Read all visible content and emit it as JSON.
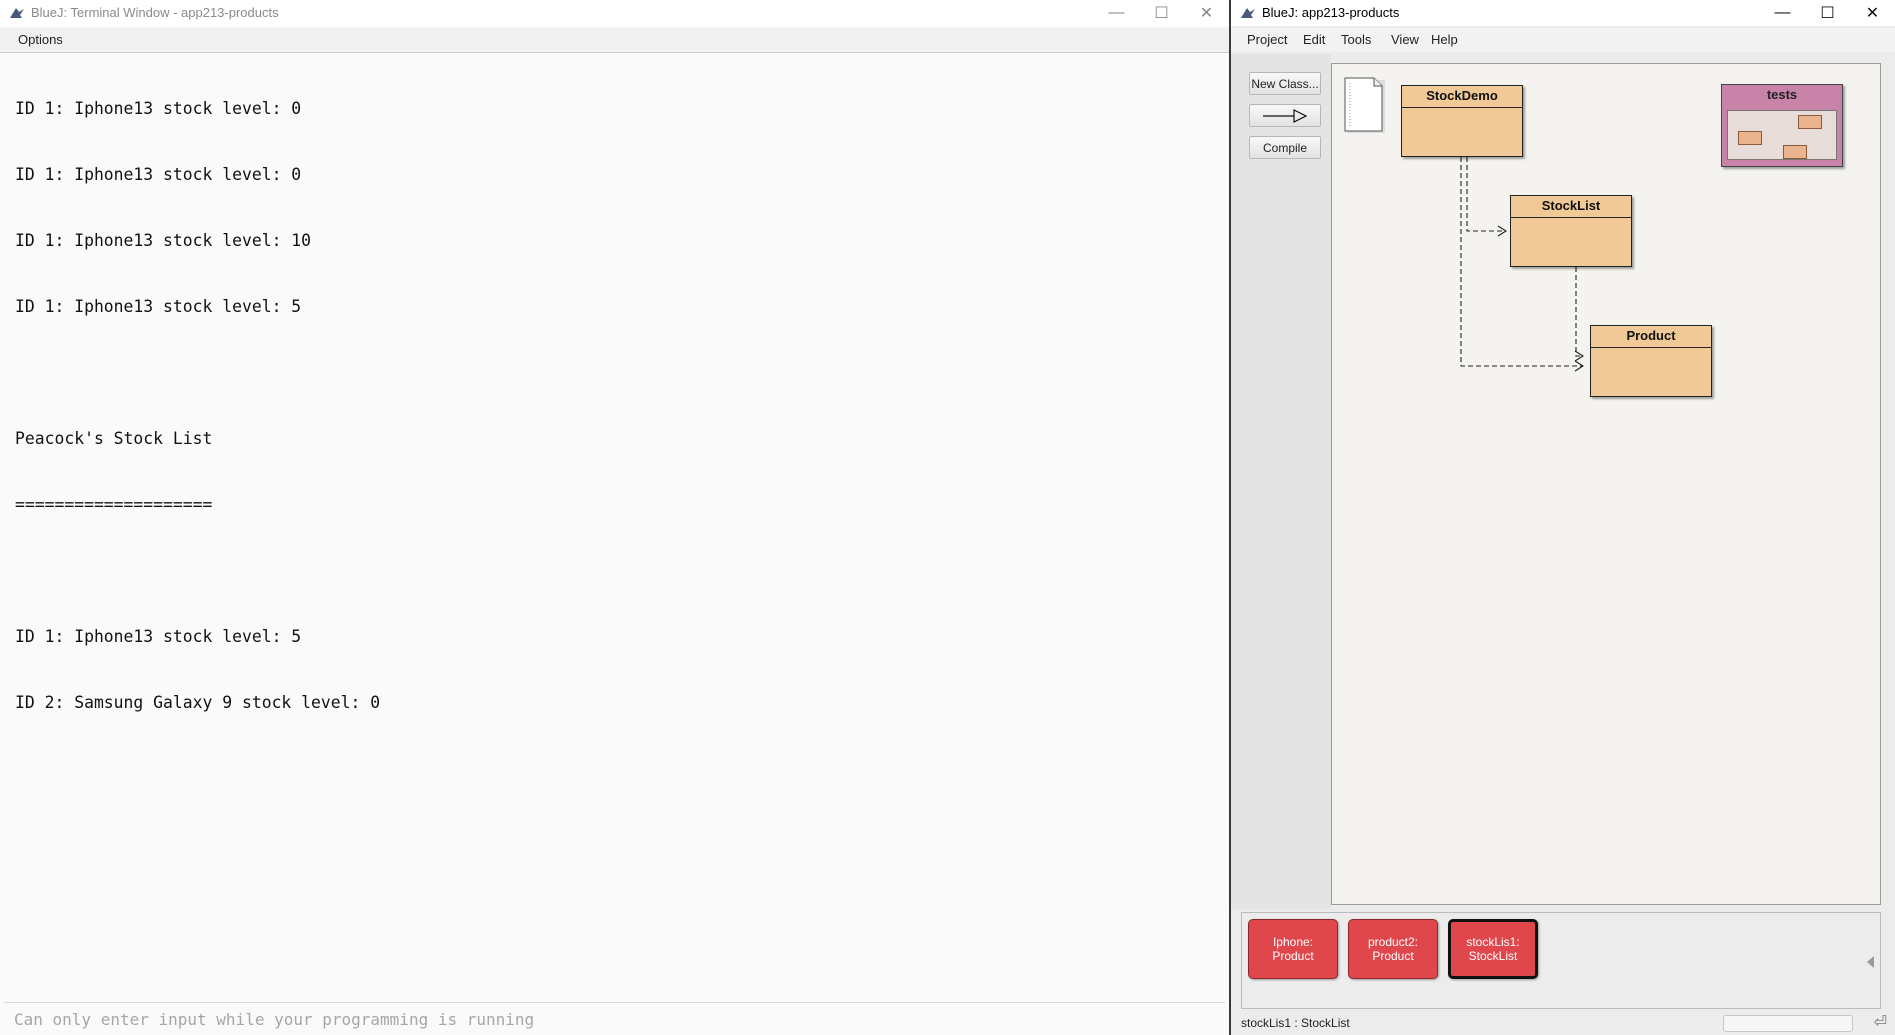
{
  "terminal": {
    "title": "BlueJ: Terminal Window - app213-products",
    "menu": {
      "options": "Options"
    },
    "output_lines": [
      "ID 1: Iphone13 stock level: 0",
      "ID 1: Iphone13 stock level: 0",
      "ID 1: Iphone13 stock level: 10",
      "ID 1: Iphone13 stock level: 5",
      "",
      "Peacock's Stock List",
      "====================",
      "",
      "ID 1: Iphone13 stock level: 5",
      "ID 2: Samsung Galaxy 9 stock level: 0"
    ],
    "input_placeholder": "Can only enter input while your programming is running",
    "controls": {
      "minimize": "—",
      "maximize": "☐",
      "close": "✕"
    }
  },
  "bluej": {
    "title": "BlueJ:  app213-products",
    "menu": {
      "project": "Project",
      "edit": "Edit",
      "tools": "Tools",
      "view": "View",
      "help": "Help"
    },
    "toolbar": {
      "new_class": "New Class...",
      "arrow": "—▷",
      "compile": "Compile"
    },
    "controls": {
      "minimize": "—",
      "maximize": "☐",
      "close": "✕"
    },
    "classes": {
      "stockdemo": "StockDemo",
      "stocklist": "StockList",
      "product": "Product"
    },
    "package": {
      "tests": "tests"
    },
    "objects": [
      {
        "line1": "Iphone:",
        "line2": "Product"
      },
      {
        "line1": "product2:",
        "line2": "Product"
      },
      {
        "line1": "stockLis1:",
        "line2": "StockList"
      }
    ],
    "status": "stockLis1 : StockList",
    "icons": {
      "app": "bluej-bird-icon",
      "readme": "readme-document-icon",
      "status": "enter-return-icon"
    }
  }
}
